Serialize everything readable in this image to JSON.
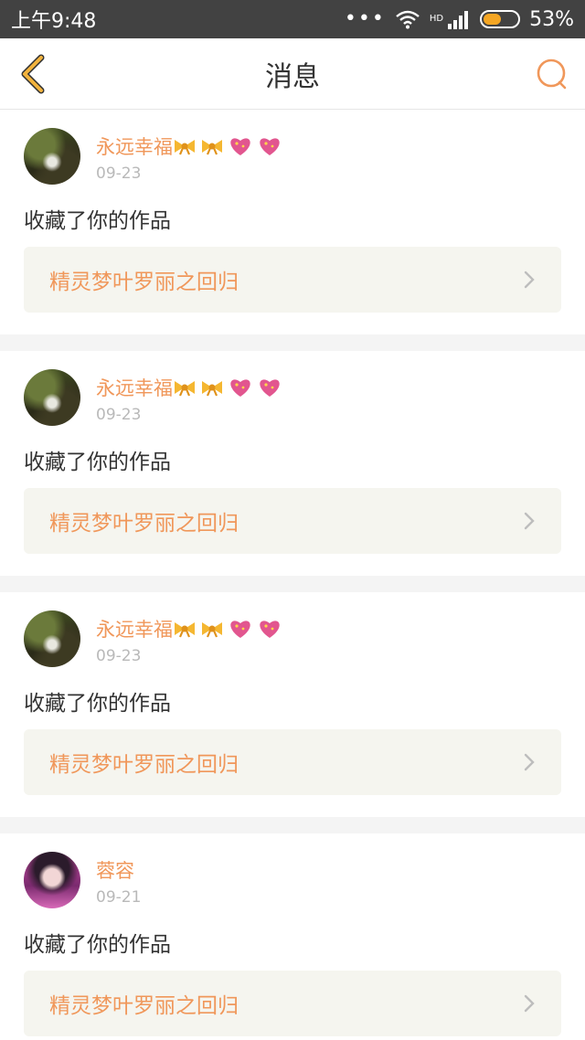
{
  "status_bar": {
    "time": "上午9:48",
    "network_label": "HD",
    "battery": "53%",
    "battery_level": 0.53
  },
  "header": {
    "title": "消息"
  },
  "messages": [
    {
      "user": "永远幸福",
      "badges": [
        "bow-emoji",
        "bow-emoji",
        "heart-emoji",
        "heart-emoji"
      ],
      "date": "09-23",
      "action": "收藏了你的作品",
      "work_title": "精灵梦叶罗丽之回归"
    },
    {
      "user": "永远幸福",
      "badges": [
        "bow-emoji",
        "bow-emoji",
        "heart-emoji",
        "heart-emoji"
      ],
      "date": "09-23",
      "action": "收藏了你的作品",
      "work_title": "精灵梦叶罗丽之回归"
    },
    {
      "user": "永远幸福",
      "badges": [
        "bow-emoji",
        "bow-emoji",
        "heart-emoji",
        "heart-emoji"
      ],
      "date": "09-23",
      "action": "收藏了你的作品",
      "work_title": "精灵梦叶罗丽之回归"
    },
    {
      "user": "蓉容",
      "badges": [],
      "date": "09-21",
      "action": "收藏了你的作品",
      "work_title": "精灵梦叶罗丽之回归"
    }
  ],
  "colors": {
    "accent": "#f0975a",
    "back_arrow": "#f2b33d",
    "statusbar": "#424242"
  }
}
